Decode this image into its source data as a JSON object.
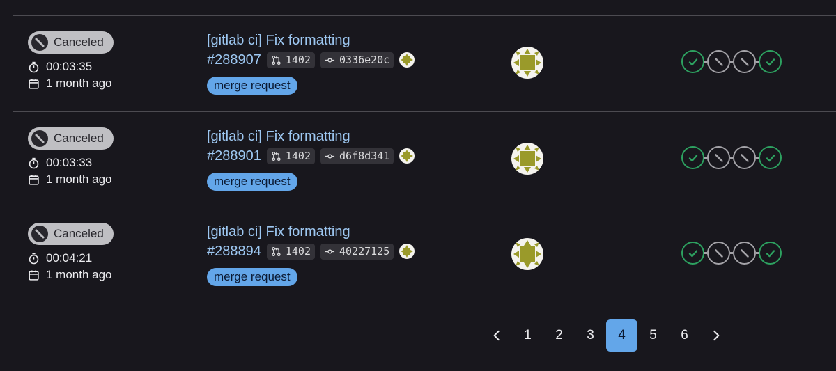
{
  "colors": {
    "background": "#18171d",
    "link": "#9dc7f1",
    "label_bg": "#63a6e9",
    "success": "#2da160",
    "canceled": "#a4a3a8",
    "active_page": "#63a6e9"
  },
  "pipelines": [
    {
      "status": "Canceled",
      "duration": "00:03:35",
      "finished": "1 month ago",
      "title": "[gitlab ci] Fix formatting",
      "id": "#288907",
      "mr": "1402",
      "commit": "0336e20c",
      "label": "merge request",
      "stages": [
        "success",
        "canceled",
        "canceled",
        "success"
      ]
    },
    {
      "status": "Canceled",
      "duration": "00:03:33",
      "finished": "1 month ago",
      "title": "[gitlab ci] Fix formatting",
      "id": "#288901",
      "mr": "1402",
      "commit": "d6f8d341",
      "label": "merge request",
      "stages": [
        "success",
        "canceled",
        "canceled",
        "success"
      ]
    },
    {
      "status": "Canceled",
      "duration": "00:04:21",
      "finished": "1 month ago",
      "title": "[gitlab ci] Fix formatting",
      "id": "#288894",
      "mr": "1402",
      "commit": "40227125",
      "label": "merge request",
      "stages": [
        "success",
        "canceled",
        "canceled",
        "success"
      ]
    }
  ],
  "pagination": {
    "pages": [
      "1",
      "2",
      "3",
      "4",
      "5",
      "6"
    ],
    "current": "4",
    "prev_icon": "chevron-left-icon",
    "next_icon": "chevron-right-icon"
  }
}
